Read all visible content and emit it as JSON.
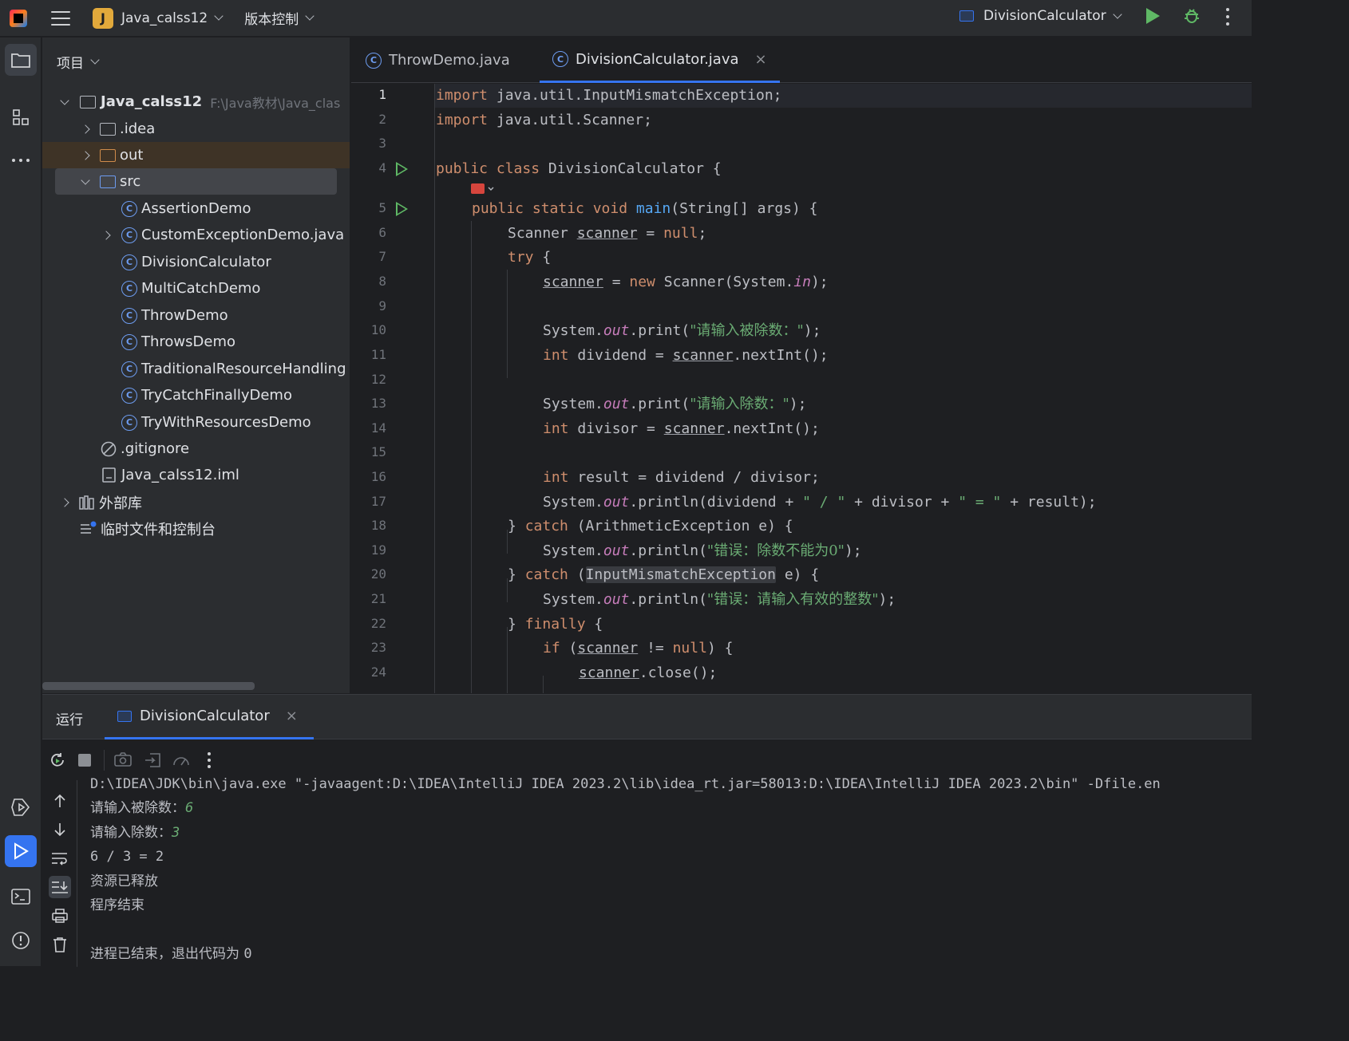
{
  "titlebar": {
    "project_badge": "J",
    "project_name": "Java_calss12",
    "vcs_label": "版本控制",
    "run_config": "DivisionCalculator"
  },
  "project_panel": {
    "title": "项目",
    "root_name": "Java_calss12",
    "root_path": "F:\\Java教材\\Java_clas",
    "items": [
      {
        "label": ".idea",
        "type": "folder"
      },
      {
        "label": "out",
        "type": "folder"
      },
      {
        "label": "src",
        "type": "folder"
      },
      {
        "label": "AssertionDemo",
        "type": "class"
      },
      {
        "label": "CustomExceptionDemo.java",
        "type": "class"
      },
      {
        "label": "DivisionCalculator",
        "type": "class"
      },
      {
        "label": "MultiCatchDemo",
        "type": "class"
      },
      {
        "label": "ThrowDemo",
        "type": "class"
      },
      {
        "label": "ThrowsDemo",
        "type": "class"
      },
      {
        "label": "TraditionalResourceHandling",
        "type": "class"
      },
      {
        "label": "TryCatchFinallyDemo",
        "type": "class"
      },
      {
        "label": "TryWithResourcesDemo",
        "type": "class"
      },
      {
        "label": ".gitignore",
        "type": "file"
      },
      {
        "label": "Java_calss12.iml",
        "type": "file"
      },
      {
        "label": "外部库",
        "type": "library"
      },
      {
        "label": "临时文件和控制台",
        "type": "scratch"
      }
    ]
  },
  "editor": {
    "tabs": [
      {
        "label": "ThrowDemo.java",
        "active": false
      },
      {
        "label": "DivisionCalculator.java",
        "active": true
      }
    ],
    "close_glyph": "×",
    "line_numbers": [
      "1",
      "2",
      "3",
      "4",
      "5",
      "6",
      "7",
      "8",
      "9",
      "10",
      "11",
      "12",
      "13",
      "14",
      "15",
      "16",
      "17",
      "18",
      "19",
      "20",
      "21",
      "22",
      "23",
      "24"
    ]
  },
  "code": {
    "l1_kw": "import",
    "l1_rest": " java.util.InputMismatchException;",
    "l2_kw": "import",
    "l2_rest": " java.util.Scanner;",
    "l4_kw": "public class",
    "l4_rest": " DivisionCalculator {",
    "l5_kw": "public static void",
    "l5_fn": "main",
    "l5_rest": "(String[] args) {",
    "l6_a": "Scanner ",
    "l6_var": "scanner",
    "l6_b": " = ",
    "l6_kw": "null",
    "l6_c": ";",
    "l7_kw": "try",
    "l7_rest": " {",
    "l8_var": "scanner",
    "l8_a": " = ",
    "l8_kw": "new",
    "l8_b": " Scanner(System.",
    "l8_st": "in",
    "l8_c": ");",
    "l10_a": "System.",
    "l10_st": "out",
    "l10_b": ".print(",
    "l10_s": "\"请输入被除数：\"",
    "l10_c": ");",
    "l11_kw": "int",
    "l11_a": " dividend = ",
    "l11_var": "scanner",
    "l11_b": ".nextInt();",
    "l13_a": "System.",
    "l13_st": "out",
    "l13_b": ".print(",
    "l13_s": "\"请输入除数：\"",
    "l13_c": ");",
    "l14_kw": "int",
    "l14_a": " divisor = ",
    "l14_var": "scanner",
    "l14_b": ".nextInt();",
    "l16_kw": "int",
    "l16_a": " result = dividend / divisor;",
    "l17_a": "System.",
    "l17_st": "out",
    "l17_b": ".println(dividend + ",
    "l17_s1": "\" / \"",
    "l17_c": " + divisor + ",
    "l17_s2": "\" = \"",
    "l17_d": " + result);",
    "l18_a": "} ",
    "l18_kw": "catch",
    "l18_b": " (ArithmeticException e) {",
    "l19_a": "System.",
    "l19_st": "out",
    "l19_b": ".println(",
    "l19_s": "\"错误：除数不能为0\"",
    "l19_c": ");",
    "l20_a": "} ",
    "l20_kw": "catch",
    "l20_b": " (",
    "l20_hl": "InputMismatchException",
    "l20_c": " e) {",
    "l21_a": "System.",
    "l21_st": "out",
    "l21_b": ".println(",
    "l21_s": "\"错误：请输入有效的整数\"",
    "l21_c": ");",
    "l22_a": "} ",
    "l22_kw": "finally",
    "l22_b": " {",
    "l23_kw": "if",
    "l23_a": " (",
    "l23_var": "scanner",
    "l23_b": " != ",
    "l23_kw2": "null",
    "l23_c": ") {",
    "l24_var": "scanner",
    "l24_a": ".close();"
  },
  "run_panel": {
    "title": "运行",
    "tab_label": "DivisionCalculator",
    "console": {
      "cmd": "D:\\IDEA\\JDK\\bin\\java.exe \"-javaagent:D:\\IDEA\\IntelliJ IDEA 2023.2\\lib\\idea_rt.jar=58013:D:\\IDEA\\IntelliJ IDEA 2023.2\\bin\" -Dfile.en",
      "prompt1": "请输入被除数：",
      "input1": "6",
      "prompt2": "请输入除数：",
      "input2": "3",
      "result": "6 / 3 = 2",
      "released": "资源已释放",
      "end": "程序结束",
      "exit_text": "进程已结束，退出代码为 ",
      "exit_code": "0"
    }
  },
  "colors": {
    "accent": "#3574f0",
    "run_green": "#5fb865",
    "keyword": "#cf8e6d",
    "string": "#6aab73",
    "static_field": "#c77dbb",
    "method_decl": "#56a8f5"
  }
}
